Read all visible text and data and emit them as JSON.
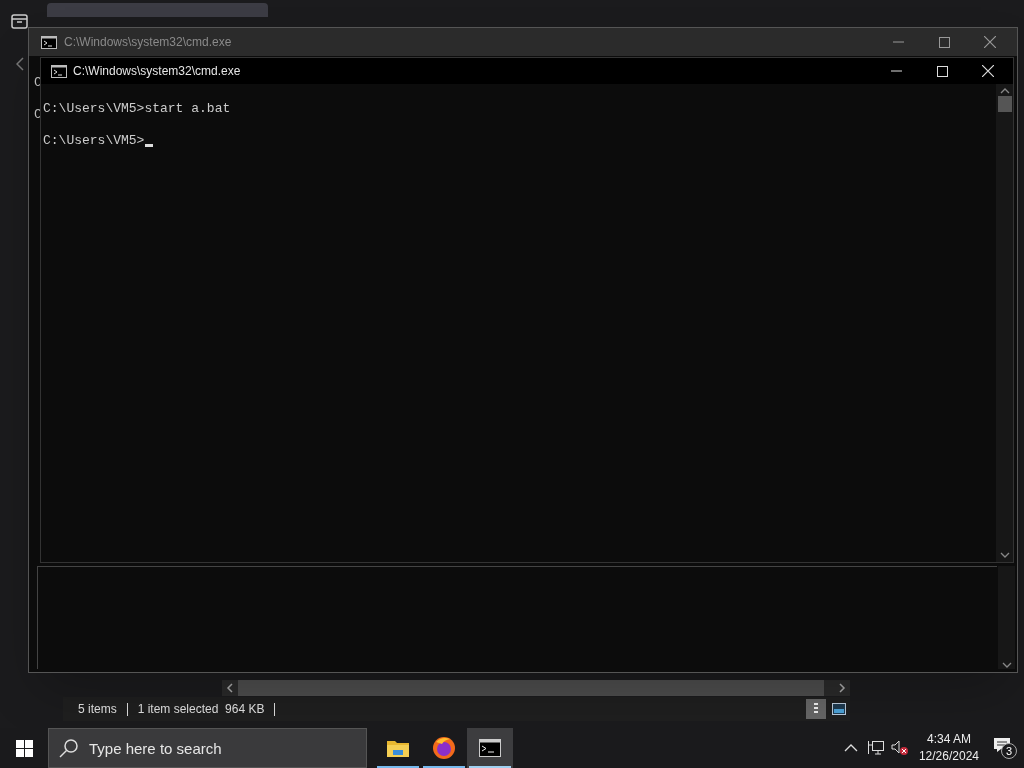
{
  "explorer": {
    "status_items": [
      "5 items",
      "1 item selected  964 KB"
    ]
  },
  "back_window": {
    "title": "C:\\Windows\\system32\\cmd.exe",
    "visible_text": [
      "C",
      "C"
    ]
  },
  "front_window": {
    "title": "C:\\Windows\\system32\\cmd.exe",
    "lines": [
      "C:\\Users\\VM5>start a.bat",
      "C:\\Users\\VM5>"
    ]
  },
  "taskbar": {
    "search": {
      "placeholder": "Type here to search"
    },
    "apps": [
      {
        "kind": "folder",
        "selected": false
      },
      {
        "kind": "firefox",
        "selected": false
      },
      {
        "kind": "terminal",
        "selected": true
      }
    ],
    "time": "4:34 AM",
    "date": "12/26/2024",
    "notifications": "3"
  }
}
